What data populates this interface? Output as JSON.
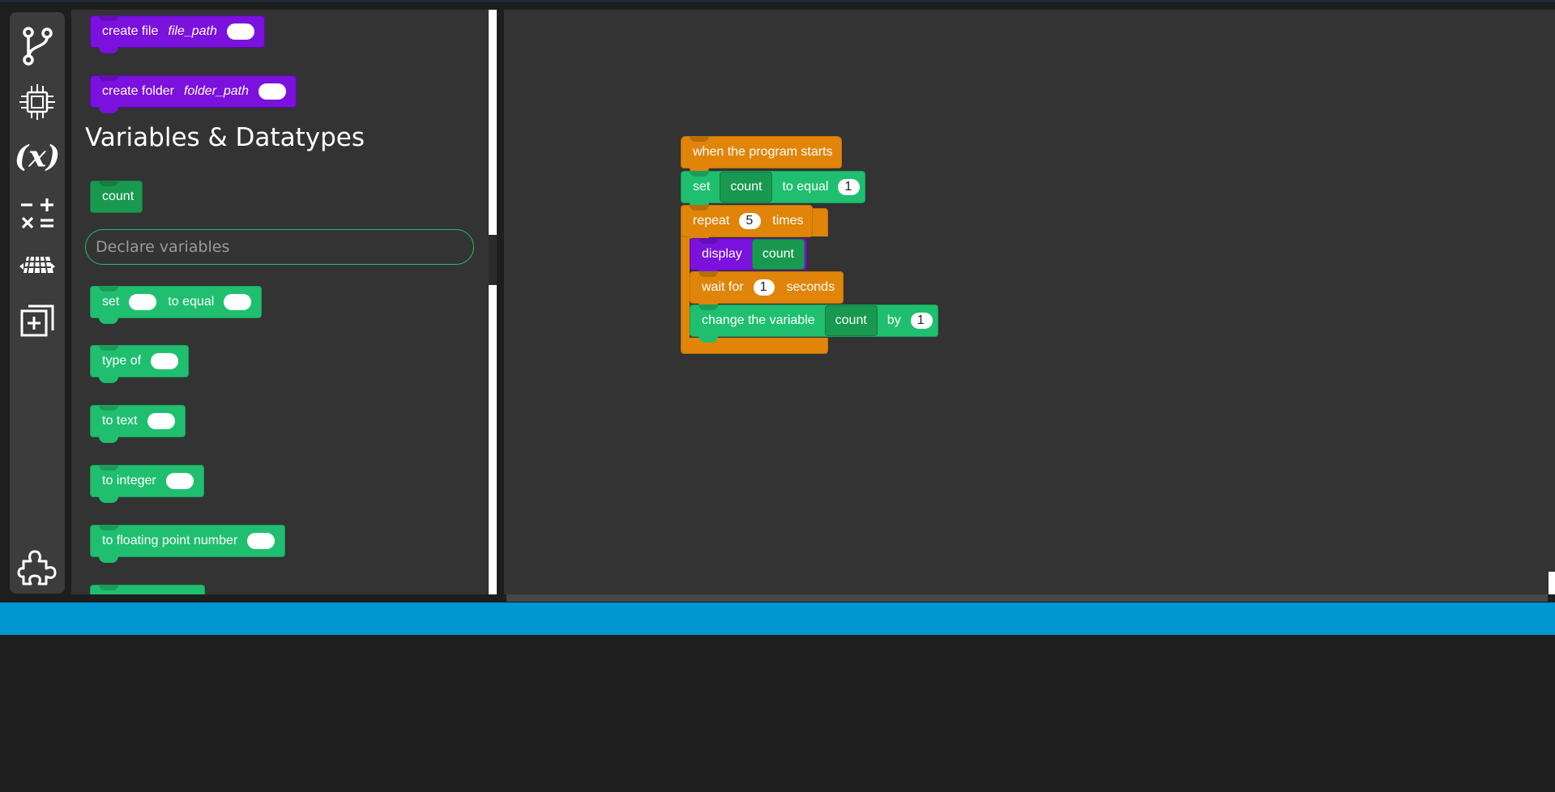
{
  "activity_bar": {
    "items": [
      {
        "icon": "branch-icon"
      },
      {
        "icon": "chip-icon"
      },
      {
        "icon": "variable-x-icon"
      },
      {
        "icon": "math-operators-icon"
      },
      {
        "icon": "cube-grid-icon"
      },
      {
        "icon": "add-copy-icon"
      },
      {
        "icon": "puzzle-icon"
      }
    ]
  },
  "palette": {
    "file_blocks": [
      {
        "label": "create file",
        "param": "file_path"
      },
      {
        "label": "create folder",
        "param": "folder_path"
      }
    ],
    "section_title": "Variables & Datatypes",
    "variable_chip": "count",
    "declare_placeholder": "Declare variables",
    "set_block": {
      "label": "set",
      "middle": "to equal"
    },
    "type_blocks": [
      {
        "label": "type of"
      },
      {
        "label": "to text"
      },
      {
        "label": "to integer"
      },
      {
        "label": "to floating point number"
      }
    ]
  },
  "workspace": {
    "hat": "when the program starts",
    "set": {
      "label": "set",
      "var": "count",
      "middle": "to equal",
      "value": "1"
    },
    "repeat": {
      "label": "repeat",
      "count": "5",
      "suffix": "times"
    },
    "display": {
      "label": "display",
      "var": "count"
    },
    "wait": {
      "label": "wait for",
      "value": "1",
      "suffix": "seconds"
    },
    "change": {
      "label": "change the variable",
      "var": "count",
      "middle": "by",
      "value": "1"
    }
  },
  "colors": {
    "files": "#7a11dc",
    "variables": "#1fbf6f",
    "variable_chip": "#18994f",
    "control": "#e0850a",
    "statusbar": "#0096d1"
  }
}
